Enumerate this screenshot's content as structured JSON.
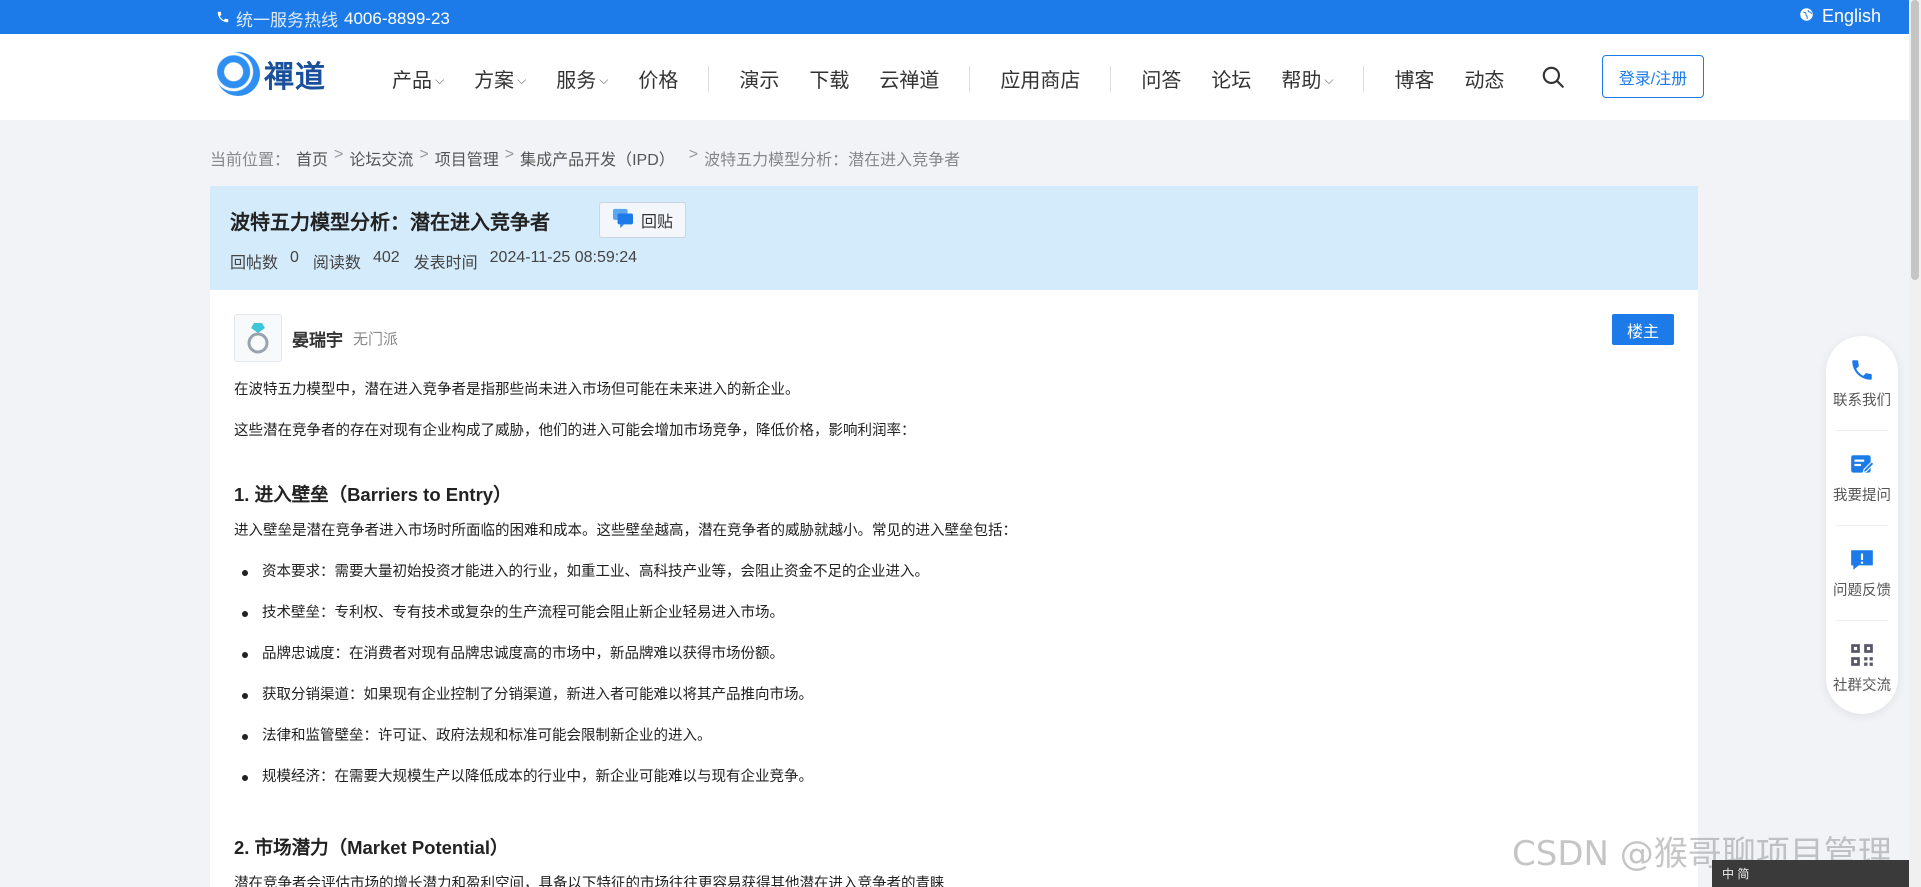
{
  "topbar": {
    "hotline_label": "统一服务热线",
    "hotline_number": "4006-8899-23",
    "language": "English"
  },
  "logo": {
    "text": "禪道"
  },
  "nav": {
    "items": [
      {
        "label": "产品",
        "dropdown": true
      },
      {
        "label": "方案",
        "dropdown": true
      },
      {
        "label": "服务",
        "dropdown": true
      },
      {
        "label": "价格",
        "dropdown": false
      },
      {
        "label": "演示",
        "dropdown": false
      },
      {
        "label": "下载",
        "dropdown": false
      },
      {
        "label": "云禅道",
        "dropdown": false
      },
      {
        "label": "应用商店",
        "dropdown": false
      },
      {
        "label": "问答",
        "dropdown": false
      },
      {
        "label": "论坛",
        "dropdown": false
      },
      {
        "label": "帮助",
        "dropdown": true
      },
      {
        "label": "博客",
        "dropdown": false
      },
      {
        "label": "动态",
        "dropdown": false
      }
    ],
    "login_label": "登录/注册"
  },
  "breadcrumb": {
    "prefix": "当前位置：",
    "crumbs": [
      "首页",
      "论坛交流",
      "项目管理",
      "集成产品开发（IPD）",
      "波特五力模型分析：潜在进入竞争者"
    ],
    "separator": ">"
  },
  "post": {
    "title": "波特五力模型分析：潜在进入竞争者",
    "reply_label": "回贴",
    "replies_label": "回帖数",
    "replies": "0",
    "views_label": "阅读数",
    "views": "402",
    "posted_label": "发表时间",
    "posted": "2024-11-25 08:59:24",
    "author": "晏瑞宇",
    "author_tag": "无门派",
    "owner_badge": "楼主"
  },
  "content": {
    "p1": "在波特五力模型中，潜在进入竞争者是指那些尚未进入市场但可能在未来进入的新企业。",
    "p2": "这些潜在竞争者的存在对现有企业构成了威胁，他们的进入可能会增加市场竞争，降低价格，影响利润率：",
    "h1": "1. 进入壁垒（Barriers to Entry）",
    "p3": "进入壁垒是潜在竞争者进入市场时所面临的困难和成本。这些壁垒越高，潜在竞争者的威胁就越小。常见的进入壁垒包括：",
    "bullets": [
      "资本要求：需要大量初始投资才能进入的行业，如重工业、高科技产业等，会阻止资金不足的企业进入。",
      "技术壁垒：专利权、专有技术或复杂的生产流程可能会阻止新企业轻易进入市场。",
      "品牌忠诚度：在消费者对现有品牌忠诚度高的市场中，新品牌难以获得市场份额。",
      "获取分销渠道：如果现有企业控制了分销渠道，新进入者可能难以将其产品推向市场。",
      "法律和监管壁垒：许可证、政府法规和标准可能会限制新企业的进入。",
      "规模经济：在需要大规模生产以降低成本的行业中，新企业可能难以与现有企业竞争。"
    ],
    "h2": "2. 市场潜力（Market Potential）",
    "p4": "潜在竞争者会评估市场的增长潜力和盈利空间，具备以下特征的市场往往更容易获得其他潜在进入竞争者的青睐"
  },
  "side_panel": [
    {
      "label": "联系我们",
      "icon": "phone-icon"
    },
    {
      "label": "我要提问",
      "icon": "edit-question-icon"
    },
    {
      "label": "问题反馈",
      "icon": "feedback-icon"
    },
    {
      "label": "社群交流",
      "icon": "qrcode-icon"
    }
  ],
  "watermark": "CSDN @猴哥聊项目管理",
  "taskbar_text": "中 简",
  "colors": {
    "primary": "#1c7be8",
    "header_bg": "#d4ebfc",
    "page_bg": "#f1f3f7"
  }
}
